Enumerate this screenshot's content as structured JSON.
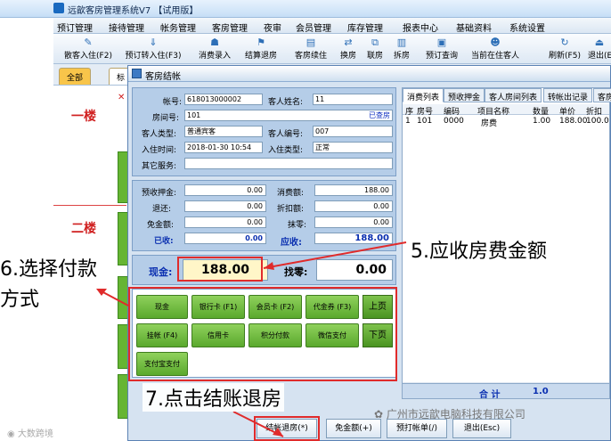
{
  "window": {
    "title": "远歆客房管理系统V7 【试用版】"
  },
  "menu": [
    "预订管理",
    "接待管理",
    "帐务管理",
    "客房管理",
    "夜审",
    "会员管理",
    "库存管理",
    "报表中心",
    "基础资料",
    "系统设置"
  ],
  "toolbar": [
    {
      "label": "散客入住(F2)",
      "icon": "user-icon"
    },
    {
      "label": "预订转入住(F3)",
      "icon": "transfer-icon"
    },
    {
      "label": "消费录入",
      "icon": "consume-icon"
    },
    {
      "label": "结算退房",
      "icon": "checkout-icon"
    },
    {
      "label": "客房续住",
      "icon": "extend-icon"
    },
    {
      "label": "换房",
      "icon": "swap-icon"
    },
    {
      "label": "联房",
      "icon": "link-icon"
    },
    {
      "label": "拆房",
      "icon": "split-icon"
    },
    {
      "label": "预订查询",
      "icon": "query-icon"
    },
    {
      "label": "当前在住客人",
      "icon": "guests-icon"
    },
    {
      "label": "刷新(F5)",
      "icon": "refresh-icon"
    },
    {
      "label": "退出(E",
      "icon": "exit-icon"
    }
  ],
  "floor_tabs": [
    "全部",
    "标"
  ],
  "floors": [
    "一楼",
    "二楼"
  ],
  "dialog": {
    "title": "客房结帐",
    "account_no_label": "帐号:",
    "account_no": "618013000002",
    "guest_name_label": "客人姓名:",
    "guest_name": "11",
    "room_no_label": "房间号:",
    "room_no": "101",
    "room_link": "已查房",
    "guest_type_label": "客人类型:",
    "guest_type": "普通宾客",
    "guest_id_label": "客人编号:",
    "guest_id": "007",
    "checkin_time_label": "入住时间:",
    "checkin_time": "2018-01-30 10:54",
    "checkin_type_label": "入住类型:",
    "checkin_type": "正常",
    "other_service_label": "其它服务:",
    "deposit_label": "预收押金:",
    "deposit": "0.00",
    "consume_label": "消费额:",
    "consume": "188.00",
    "refund_label": "退还:",
    "refund": "0.00",
    "discount_label": "折扣额:",
    "discount": "0.00",
    "free_label": "免金额:",
    "free": "0.00",
    "round_label": "抹零:",
    "round": "0.00",
    "received_label": "已收:",
    "received": "0.00",
    "receivable_label": "应收:",
    "receivable": "188.00",
    "cash_label": "现金:",
    "cash": "188.00",
    "change_label": "找零:",
    "change": "0.00"
  },
  "payment": {
    "buttons": [
      "现金",
      "银行卡 (F1)",
      "会员卡 (F2)",
      "代金券 (F3)",
      "挂帐 (F4)",
      "信用卡",
      "积分付款",
      "微信支付",
      "支付宝支付"
    ],
    "page_up": "上页",
    "page_down": "下页"
  },
  "consume_tabs": [
    "消费列表",
    "预收押金",
    "客人房间列表",
    "转帐出记录",
    "客房"
  ],
  "consume_table": {
    "headers": [
      "序",
      "房号",
      "编码",
      "项目名称",
      "数量",
      "单价",
      "折扣"
    ],
    "rows": [
      [
        "1",
        "101",
        "0000",
        "房费",
        "1.00",
        "188.00",
        "100.0"
      ]
    ],
    "total_label": "合 计",
    "total_value": "1.0"
  },
  "bottom_buttons": [
    "结帐退房(*)",
    "免金额(+)",
    "预打帐单(/)",
    "退出(Esc)"
  ],
  "annotations": {
    "a5": "5.应收房费金额",
    "a6_line1": "6.选择付款",
    "a6_line2": "方式",
    "a7": "7.点击结账退房"
  },
  "watermark_left": "大数跨境",
  "watermark_right": "广州市远歆电脑科技有限公司",
  "colors": {
    "accent_green": "#5aa92d",
    "annotation_red": "#e02b2b",
    "title_blue": "#0a2fb0"
  }
}
